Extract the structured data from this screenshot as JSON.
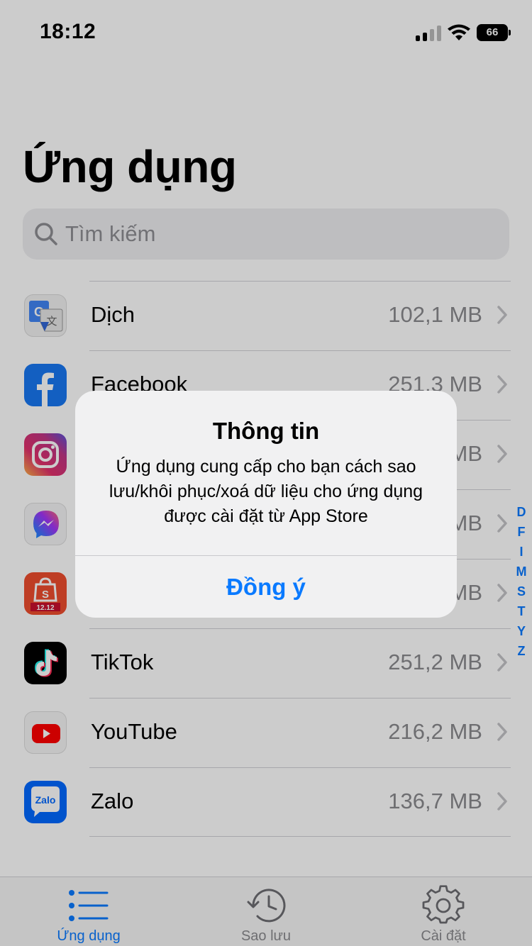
{
  "status_bar": {
    "time": "18:12",
    "battery": "66"
  },
  "page": {
    "title": "Ứng dụng"
  },
  "search": {
    "placeholder": "Tìm kiếm"
  },
  "apps": [
    {
      "name": "Dịch",
      "size": "102,1 MB",
      "icon": "google-translate-icon"
    },
    {
      "name": "Facebook",
      "size": "251,3 MB",
      "icon": "facebook-icon"
    },
    {
      "name": "",
      "size": "MB",
      "icon": "instagram-icon"
    },
    {
      "name": "",
      "size": "MB",
      "icon": "messenger-icon"
    },
    {
      "name": "",
      "size": "MB",
      "icon": "shopee-icon"
    },
    {
      "name": "TikTok",
      "size": "251,2 MB",
      "icon": "tiktok-icon"
    },
    {
      "name": "YouTube",
      "size": "216,2 MB",
      "icon": "youtube-icon"
    },
    {
      "name": "Zalo",
      "size": "136,7 MB",
      "icon": "zalo-icon"
    }
  ],
  "index_letters": [
    "D",
    "F",
    "I",
    "M",
    "S",
    "T",
    "Y",
    "Z"
  ],
  "tabs": [
    {
      "label": "Ứng dụng",
      "icon": "list-icon",
      "active": true
    },
    {
      "label": "Sao lưu",
      "icon": "history-icon",
      "active": false
    },
    {
      "label": "Cài đặt",
      "icon": "gear-icon",
      "active": false
    }
  ],
  "alert": {
    "title": "Thông tin",
    "message": "Ứng dụng cung cấp cho bạn cách sao lưu/khôi phục/xoá dữ liệu cho ứng dụng được cài đặt từ App Store",
    "button": "Đồng ý"
  },
  "colors": {
    "accent": "#0a7aff",
    "secondary_text": "#8a8a8e"
  }
}
